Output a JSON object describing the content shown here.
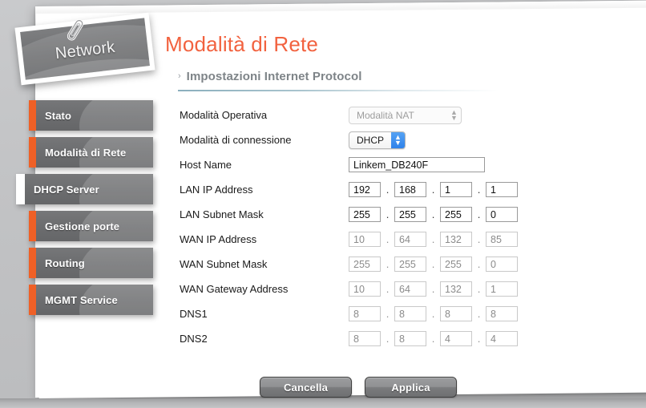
{
  "brand": {
    "logo_label": "Network",
    "accent_orange": "#ef6026",
    "title_orange": "#f2623f",
    "nav_gray": "#6c6d6f"
  },
  "sidebar": {
    "items": [
      {
        "label": "Stato",
        "active": false
      },
      {
        "label": "Modalità di Rete",
        "active": false
      },
      {
        "label": "DHCP Server",
        "active": true
      },
      {
        "label": "Gestione porte",
        "active": false
      },
      {
        "label": "Routing",
        "active": false
      },
      {
        "label": "MGMT Service",
        "active": false
      }
    ]
  },
  "main": {
    "page_title": "Modalità di Rete",
    "section_chevron": "›",
    "section_title": "Impostazioni Internet Protocol",
    "fields": {
      "operating_mode_label": "Modalità Operativa",
      "operating_mode_value": "Modalità NAT",
      "connection_mode_label": "Modalità di connessione",
      "connection_mode_value": "DHCP",
      "host_name_label": "Host Name",
      "host_name_value": "Linkem_DB240F",
      "lan_ip_label": "LAN IP Address",
      "lan_ip_octets": [
        "192",
        "168",
        "1",
        "1"
      ],
      "lan_mask_label": "LAN Subnet Mask",
      "lan_mask_octets": [
        "255",
        "255",
        "255",
        "0"
      ],
      "wan_ip_label": "WAN IP Address",
      "wan_ip_octets": [
        "10",
        "64",
        "132",
        "85"
      ],
      "wan_mask_label": "WAN Subnet Mask",
      "wan_mask_octets": [
        "255",
        "255",
        "255",
        "0"
      ],
      "wan_gw_label": "WAN Gateway Address",
      "wan_gw_octets": [
        "10",
        "64",
        "132",
        "1"
      ],
      "dns1_label": "DNS1",
      "dns1_octets": [
        "8",
        "8",
        "8",
        "8"
      ],
      "dns2_label": "DNS2",
      "dns2_octets": [
        "8",
        "8",
        "4",
        "4"
      ],
      "octet_separator": "."
    },
    "buttons": {
      "cancel_label": "Cancella",
      "apply_label": "Applica"
    }
  }
}
